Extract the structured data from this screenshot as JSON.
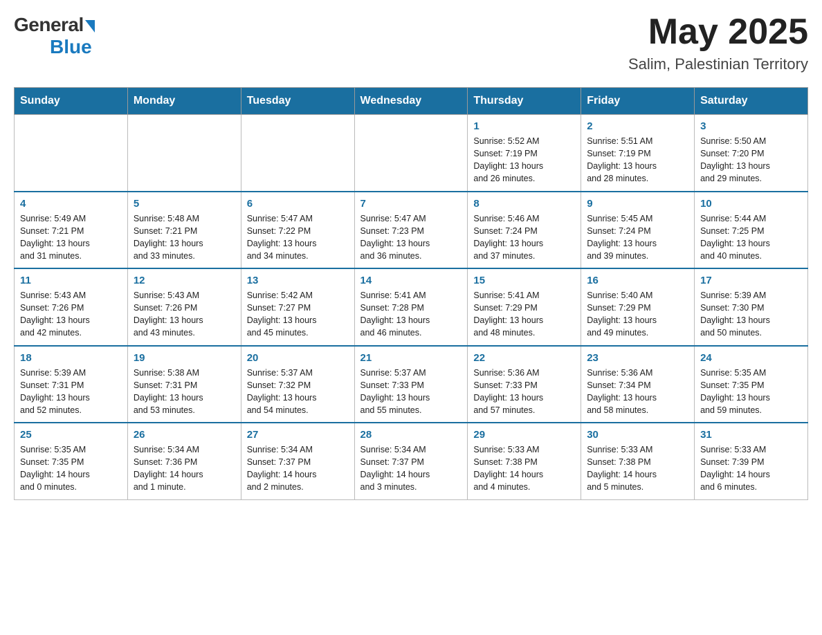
{
  "header": {
    "logo_general": "General",
    "logo_blue": "Blue",
    "month_title": "May 2025",
    "location": "Salim, Palestinian Territory"
  },
  "days_of_week": [
    "Sunday",
    "Monday",
    "Tuesday",
    "Wednesday",
    "Thursday",
    "Friday",
    "Saturday"
  ],
  "weeks": [
    {
      "days": [
        {
          "date": "",
          "info": ""
        },
        {
          "date": "",
          "info": ""
        },
        {
          "date": "",
          "info": ""
        },
        {
          "date": "",
          "info": ""
        },
        {
          "date": "1",
          "info": "Sunrise: 5:52 AM\nSunset: 7:19 PM\nDaylight: 13 hours\nand 26 minutes."
        },
        {
          "date": "2",
          "info": "Sunrise: 5:51 AM\nSunset: 7:19 PM\nDaylight: 13 hours\nand 28 minutes."
        },
        {
          "date": "3",
          "info": "Sunrise: 5:50 AM\nSunset: 7:20 PM\nDaylight: 13 hours\nand 29 minutes."
        }
      ]
    },
    {
      "days": [
        {
          "date": "4",
          "info": "Sunrise: 5:49 AM\nSunset: 7:21 PM\nDaylight: 13 hours\nand 31 minutes."
        },
        {
          "date": "5",
          "info": "Sunrise: 5:48 AM\nSunset: 7:21 PM\nDaylight: 13 hours\nand 33 minutes."
        },
        {
          "date": "6",
          "info": "Sunrise: 5:47 AM\nSunset: 7:22 PM\nDaylight: 13 hours\nand 34 minutes."
        },
        {
          "date": "7",
          "info": "Sunrise: 5:47 AM\nSunset: 7:23 PM\nDaylight: 13 hours\nand 36 minutes."
        },
        {
          "date": "8",
          "info": "Sunrise: 5:46 AM\nSunset: 7:24 PM\nDaylight: 13 hours\nand 37 minutes."
        },
        {
          "date": "9",
          "info": "Sunrise: 5:45 AM\nSunset: 7:24 PM\nDaylight: 13 hours\nand 39 minutes."
        },
        {
          "date": "10",
          "info": "Sunrise: 5:44 AM\nSunset: 7:25 PM\nDaylight: 13 hours\nand 40 minutes."
        }
      ]
    },
    {
      "days": [
        {
          "date": "11",
          "info": "Sunrise: 5:43 AM\nSunset: 7:26 PM\nDaylight: 13 hours\nand 42 minutes."
        },
        {
          "date": "12",
          "info": "Sunrise: 5:43 AM\nSunset: 7:26 PM\nDaylight: 13 hours\nand 43 minutes."
        },
        {
          "date": "13",
          "info": "Sunrise: 5:42 AM\nSunset: 7:27 PM\nDaylight: 13 hours\nand 45 minutes."
        },
        {
          "date": "14",
          "info": "Sunrise: 5:41 AM\nSunset: 7:28 PM\nDaylight: 13 hours\nand 46 minutes."
        },
        {
          "date": "15",
          "info": "Sunrise: 5:41 AM\nSunset: 7:29 PM\nDaylight: 13 hours\nand 48 minutes."
        },
        {
          "date": "16",
          "info": "Sunrise: 5:40 AM\nSunset: 7:29 PM\nDaylight: 13 hours\nand 49 minutes."
        },
        {
          "date": "17",
          "info": "Sunrise: 5:39 AM\nSunset: 7:30 PM\nDaylight: 13 hours\nand 50 minutes."
        }
      ]
    },
    {
      "days": [
        {
          "date": "18",
          "info": "Sunrise: 5:39 AM\nSunset: 7:31 PM\nDaylight: 13 hours\nand 52 minutes."
        },
        {
          "date": "19",
          "info": "Sunrise: 5:38 AM\nSunset: 7:31 PM\nDaylight: 13 hours\nand 53 minutes."
        },
        {
          "date": "20",
          "info": "Sunrise: 5:37 AM\nSunset: 7:32 PM\nDaylight: 13 hours\nand 54 minutes."
        },
        {
          "date": "21",
          "info": "Sunrise: 5:37 AM\nSunset: 7:33 PM\nDaylight: 13 hours\nand 55 minutes."
        },
        {
          "date": "22",
          "info": "Sunrise: 5:36 AM\nSunset: 7:33 PM\nDaylight: 13 hours\nand 57 minutes."
        },
        {
          "date": "23",
          "info": "Sunrise: 5:36 AM\nSunset: 7:34 PM\nDaylight: 13 hours\nand 58 minutes."
        },
        {
          "date": "24",
          "info": "Sunrise: 5:35 AM\nSunset: 7:35 PM\nDaylight: 13 hours\nand 59 minutes."
        }
      ]
    },
    {
      "days": [
        {
          "date": "25",
          "info": "Sunrise: 5:35 AM\nSunset: 7:35 PM\nDaylight: 14 hours\nand 0 minutes."
        },
        {
          "date": "26",
          "info": "Sunrise: 5:34 AM\nSunset: 7:36 PM\nDaylight: 14 hours\nand 1 minute."
        },
        {
          "date": "27",
          "info": "Sunrise: 5:34 AM\nSunset: 7:37 PM\nDaylight: 14 hours\nand 2 minutes."
        },
        {
          "date": "28",
          "info": "Sunrise: 5:34 AM\nSunset: 7:37 PM\nDaylight: 14 hours\nand 3 minutes."
        },
        {
          "date": "29",
          "info": "Sunrise: 5:33 AM\nSunset: 7:38 PM\nDaylight: 14 hours\nand 4 minutes."
        },
        {
          "date": "30",
          "info": "Sunrise: 5:33 AM\nSunset: 7:38 PM\nDaylight: 14 hours\nand 5 minutes."
        },
        {
          "date": "31",
          "info": "Sunrise: 5:33 AM\nSunset: 7:39 PM\nDaylight: 14 hours\nand 6 minutes."
        }
      ]
    }
  ]
}
